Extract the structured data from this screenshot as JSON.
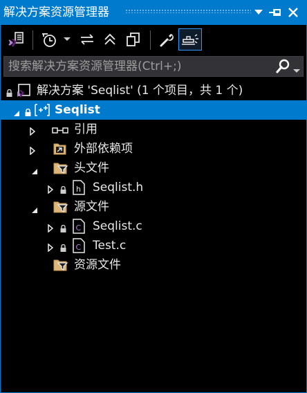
{
  "window": {
    "title": "解决方案资源管理器",
    "accent": "#007acc"
  },
  "toolbar": {
    "items": [
      {
        "icon": "vs-solution-switch-icon"
      },
      {
        "icon": "history-clock-icon"
      },
      {
        "icon": "dropdown-arrow-icon"
      },
      {
        "icon": "sync-arrows-icon"
      },
      {
        "icon": "collapse-all-icon"
      },
      {
        "icon": "copy-windows-icon"
      },
      {
        "icon": "wrench-properties-icon"
      },
      {
        "icon": "preview-pin-icon",
        "active": true
      }
    ]
  },
  "search": {
    "placeholder": "搜索解决方案资源管理器(Ctrl+;)",
    "value": ""
  },
  "tree": {
    "solution_label": "解决方案 'Seqlist' (1 个项目，共 1 个)",
    "project_label": "Seqlist",
    "references_label": "引用",
    "external_deps_label": "外部依赖项",
    "header_files_label": "头文件",
    "header_file_1": "Seqlist.h",
    "source_files_label": "源文件",
    "source_file_1": "Seqlist.c",
    "source_file_2": "Test.c",
    "resource_files_label": "资源文件"
  }
}
